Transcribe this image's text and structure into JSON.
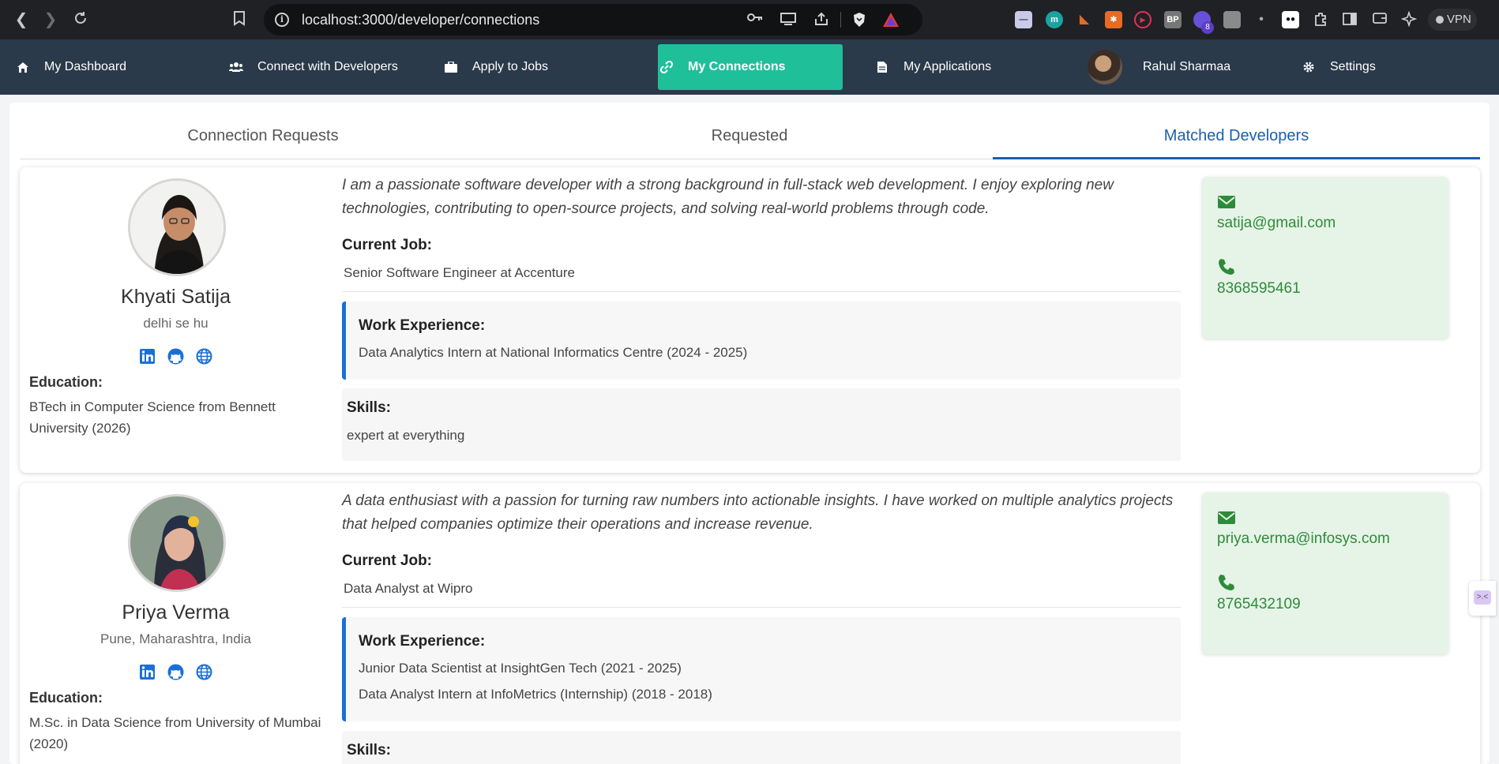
{
  "browser": {
    "url": "localhost:3000/developer/connections",
    "vpn_label": "VPN",
    "ext_badge": "8",
    "ext_bp": "BP"
  },
  "nav": {
    "items": [
      {
        "label": "My Dashboard",
        "icon": "home-icon"
      },
      {
        "label": "Connect with Developers",
        "icon": "users-icon"
      },
      {
        "label": "Apply to Jobs",
        "icon": "briefcase-icon"
      },
      {
        "label": "My Connections",
        "icon": "link-icon"
      },
      {
        "label": "My Applications",
        "icon": "file-icon"
      },
      {
        "label": "Rahul Sharmaa",
        "icon": "avatar"
      },
      {
        "label": "Settings",
        "icon": "gear-icon"
      }
    ],
    "active": "My Connections"
  },
  "tabs": [
    {
      "label": "Connection Requests"
    },
    {
      "label": "Requested"
    },
    {
      "label": "Matched Developers"
    }
  ],
  "labels": {
    "current_job": "Current Job:",
    "work_experience": "Work Experience:",
    "skills": "Skills:",
    "education": "Education:"
  },
  "developers": [
    {
      "name": "Khyati Satija",
      "location": "delhi se hu",
      "education": "BTech in Computer Science from Bennett University (2026)",
      "bio": "I am a passionate software developer with a strong background in full-stack web development. I enjoy exploring new technologies, contributing to open-source projects, and solving real-world problems through code.",
      "current_job": "Senior Software Engineer at Accenture",
      "work_experience": [
        "Data Analytics Intern at National Informatics Centre (2024 - 2025)"
      ],
      "skills": "expert at everything",
      "email": "satija@gmail.com",
      "phone": "8368595461"
    },
    {
      "name": "Priya Verma",
      "location": "Pune, Maharashtra, India",
      "education": "M.Sc. in Data Science from University of Mumbai (2020)",
      "bio": "A data enthusiast with a passion for turning raw numbers into actionable insights. I have worked on multiple analytics projects that helped companies optimize their operations and increase revenue.",
      "current_job": "Data Analyst at Wipro",
      "work_experience": [
        "Junior Data Scientist at InsightGen Tech (2021 - 2025)",
        "Data Analyst Intern at InfoMetrics (Internship) (2018 - 2018)"
      ],
      "skills": "",
      "email": "priya.verma@infosys.com",
      "phone": "8765432109"
    }
  ],
  "colors": {
    "nav_bg": "#2b3a4a",
    "nav_active": "#1fbf9a",
    "tab_active": "#1a5fae",
    "contact_bg": "#e6f4e7",
    "contact_text": "#2e8b3a",
    "social_blue": "#1a6fd6"
  }
}
